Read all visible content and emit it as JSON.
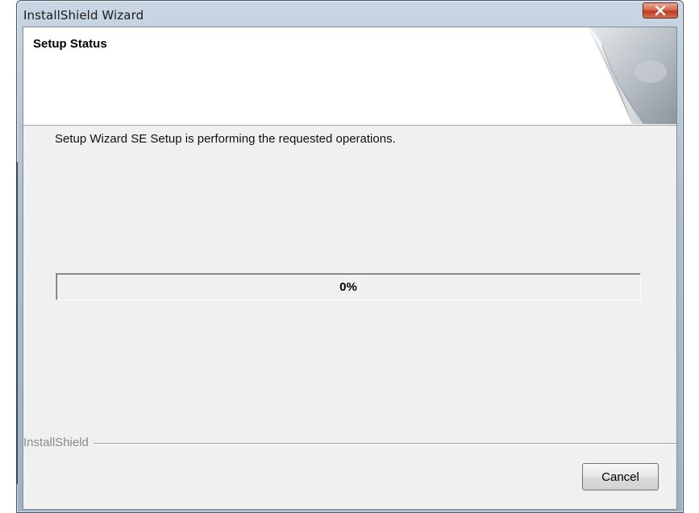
{
  "window": {
    "title": "InstallShield Wizard",
    "close_icon": "close-icon"
  },
  "header": {
    "title": "Setup Status",
    "graphic_icon": "page-curl-graphic"
  },
  "main": {
    "status_text": "Setup Wizard SE Setup is performing the requested operations.",
    "progress": {
      "percent_label": "0%",
      "value": 0
    }
  },
  "footer": {
    "brand": "InstallShield",
    "cancel_label": "Cancel"
  },
  "colors": {
    "close_button": "#c2391e",
    "panel_background": "#f0f0f0",
    "header_background": "#ffffff"
  }
}
